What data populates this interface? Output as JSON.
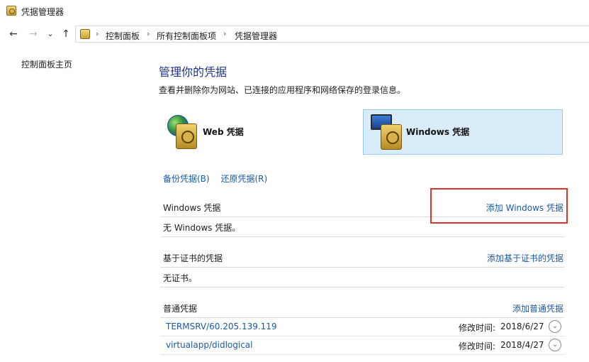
{
  "window": {
    "title": "凭据管理器"
  },
  "nav": {
    "back": "←",
    "forward": "→",
    "recent": "⌄",
    "up": "↑"
  },
  "address": {
    "chev0": "›",
    "crumbs": [
      "控制面板",
      "所有控制面板项",
      "凭据管理器"
    ],
    "sep": "›"
  },
  "left_nav": {
    "home_link": "控制面板主页"
  },
  "main": {
    "heading": "管理你的凭据",
    "description": "查看并删除你为网站、已连接的应用程序和网络保存的登录信息。",
    "tiles": {
      "web": "Web 凭据",
      "windows": "Windows 凭据"
    },
    "actions": {
      "backup": "备份凭据(B)",
      "restore": "还原凭据(R)"
    },
    "sections": {
      "windows": {
        "title": "Windows 凭据",
        "add": "添加 Windows 凭据",
        "empty": "无 Windows 凭据。"
      },
      "certificate": {
        "title": "基于证书的凭据",
        "add": "添加基于证书的凭据",
        "empty": "无证书。"
      },
      "generic": {
        "title": "普通凭据",
        "add": "添加普通凭据",
        "items": [
          {
            "name": "TERMSRV/60.205.139.119",
            "modified_label": "修改时间:",
            "modified": "2018/6/27"
          },
          {
            "name": "virtualapp/didlogical",
            "modified_label": "修改时间:",
            "modified": "2018/4/27"
          }
        ]
      }
    }
  },
  "icons": {
    "expand": "⌄"
  },
  "colors": {
    "link": "#1a5aa6",
    "heading": "#1e3287",
    "selected_tile": "#d9ecfa",
    "highlight": "#d9362b"
  }
}
